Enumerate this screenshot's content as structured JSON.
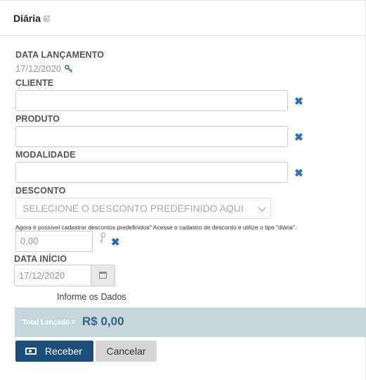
{
  "header": {
    "title": "Diária"
  },
  "form": {
    "data_lancamento": {
      "label": "DATA LANÇAMENTO",
      "value": "17/12/2020"
    },
    "cliente": {
      "label": "CLIENTE",
      "value": ""
    },
    "produto": {
      "label": "PRODUTO",
      "value": ""
    },
    "modalidade": {
      "label": "MODALIDADE",
      "value": ""
    },
    "desconto": {
      "label": "DESCONTO",
      "selected": "SELECIONE O DESCONTO PREDEFINIDO AQUI",
      "note": "Agora é possível cadastrar descontos predefinidos\" Acesse o cadastro de desconto e utilize o tipo \"diária\".",
      "value_placeholder": "0,00"
    },
    "data_inicio": {
      "label": "DATA INÍCIO",
      "value": "17/12/2020"
    },
    "info_text": "Informe os Dados"
  },
  "total": {
    "label": "Total Lançado =",
    "value": "R$ 0,00"
  },
  "actions": {
    "receber": "Receber",
    "cancelar": "Cancelar"
  }
}
